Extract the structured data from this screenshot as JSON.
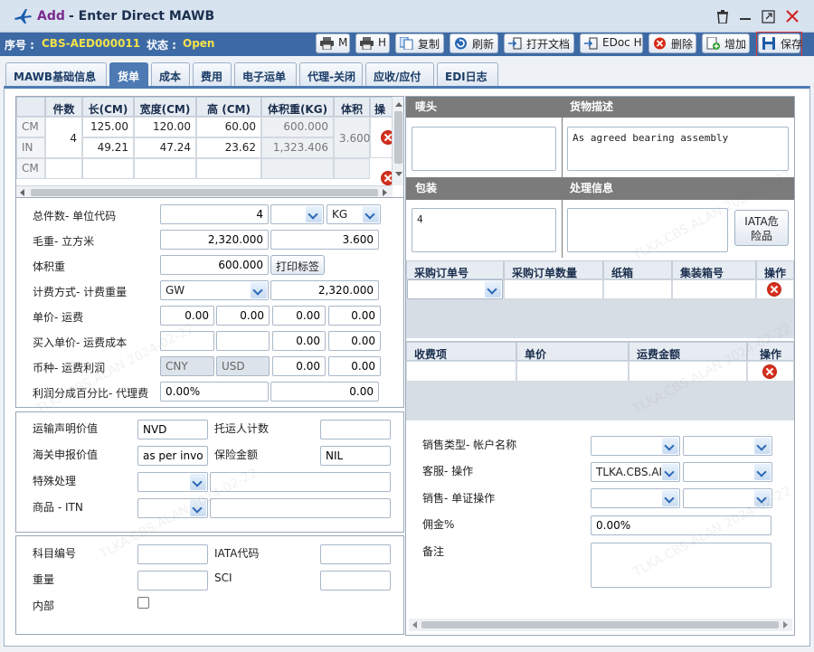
{
  "window": {
    "title_prefix": "Add",
    "title_rest": "- Enter Direct MAWB"
  },
  "status": {
    "seq_label": "序号 :",
    "seq_value": "CBS-AED000011",
    "state_label": "状态 :",
    "state_value": "Open"
  },
  "toolbar": {
    "print_m": "M",
    "print_h": "H",
    "copy": "复制",
    "refresh": "刷新",
    "open_doc": "打开文档",
    "edoc": "EDoc H",
    "delete": "删除",
    "add": "增加",
    "save": "保存"
  },
  "tabs": [
    "MAWB基础信息",
    "货单",
    "成本",
    "费用",
    "电子运单",
    "代理-关闭",
    "应收/应付",
    "EDI日志"
  ],
  "dims_table": {
    "headers": [
      "件数",
      "长(CM)",
      "宽度(CM)",
      "高 (CM)",
      "体积重(KG)",
      "体积",
      "操"
    ],
    "pieces": "4",
    "volume": "3.600",
    "rows": [
      {
        "unit": "CM",
        "l": "125.00",
        "w": "120.00",
        "h": "60.00",
        "vw": "600.000"
      },
      {
        "unit": "IN",
        "l": "49.21",
        "w": "47.24",
        "h": "23.62",
        "vw": "1,323.406"
      },
      {
        "unit": "CM",
        "l": "",
        "w": "",
        "h": "",
        "vw": ""
      }
    ]
  },
  "form": {
    "total_pieces_label": "总件数- 单位代码",
    "total_pieces": "4",
    "unit_code": "KG",
    "gross_weight_label": "毛重- 立方米",
    "gross_weight": "2,320.000",
    "cbm": "3.600",
    "volume_weight_label": "体积重",
    "volume_weight": "600.000",
    "print_label_btn": "打印标签",
    "charge_method_label": "计费方式- 计费重量",
    "charge_method": "GW",
    "charge_weight": "2,320.000",
    "unit_price_label": "单价- 运费",
    "unit_price": [
      "0.00",
      "0.00",
      "0.00",
      "0.00"
    ],
    "buy_price_label": "买入单价- 运费成本",
    "buy_price": [
      "",
      "",
      "0.00",
      "0.00"
    ],
    "currency_label": "币种- 运费利润",
    "currency1": "CNY",
    "currency2": "USD",
    "profit": [
      "0.00",
      "0.00"
    ],
    "share_label": "利润分成百分比- 代理费",
    "share_pct": "0.00%",
    "agent_fee": "0.00"
  },
  "form2": {
    "carriage_value_label": "运输声明价值",
    "carriage_value": "NVD",
    "shipper_count_label": "托运人计数",
    "shipper_count": "",
    "customs_value_label": "海关申报价值",
    "customs_value": "as per invoic",
    "insurance_label": "保险金额",
    "insurance": "NIL",
    "special_label": "特殊处理",
    "itn_label": "商品 - ITN"
  },
  "form3": {
    "account_label": "科目编号",
    "iata_code_label": "IATA代码",
    "weight_label": "重量",
    "sci_label": "SCI",
    "internal_label": "内部"
  },
  "right": {
    "marks_label": "唛头",
    "goods_desc_label": "货物描述",
    "goods_desc": "As agreed bearing assembly",
    "packing_label": "包装",
    "packing": "4",
    "handling_label": "处理信息",
    "iata_dg_btn": "IATA危险品",
    "po_headers": [
      "采购订单号",
      "采购订单数量",
      "纸箱",
      "集装箱号",
      "操作"
    ],
    "fee_headers": [
      "收费项",
      "单价",
      "运费金额",
      "操作"
    ],
    "sales_type_label": "销售类型- 帐户名称",
    "cs_label": "客服- 操作",
    "cs_value": "TLKA.CBS.AI",
    "sales_label": "销售- 单证操作",
    "commission_label": "佣金%",
    "commission": "0.00%",
    "remark_label": "备注"
  },
  "watermark": "TLKA.CBS.ALAN 2024-02-22",
  "colors": {
    "title_bar": "#d8e3f0",
    "status_bar": "#3d6aa5",
    "active_tab": "#4d7ab3",
    "state_open": "#f2e14a"
  }
}
